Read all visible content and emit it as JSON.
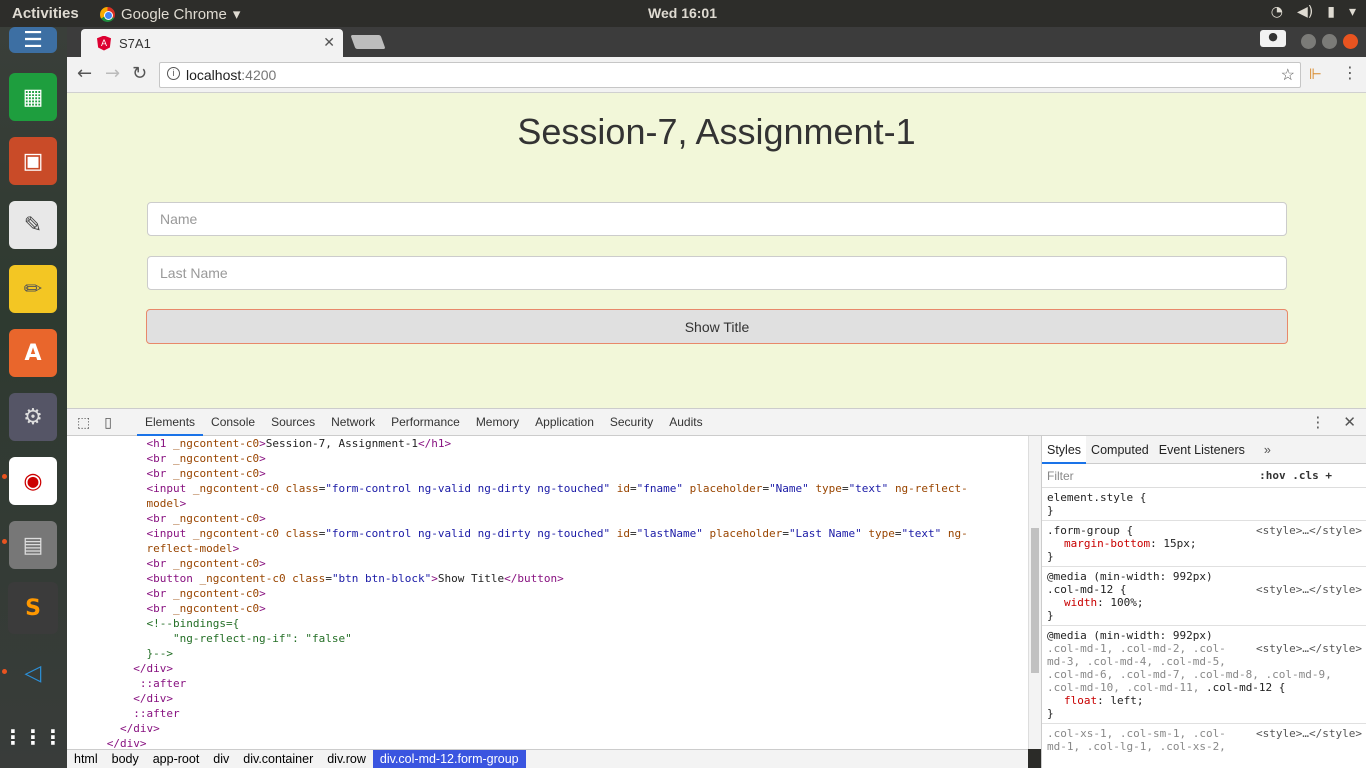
{
  "os_bar": {
    "activities": "Activities",
    "app_name": "Google Chrome",
    "clock": "Wed 16:01"
  },
  "dock": {
    "items": [
      "libreoffice-writer",
      "libreoffice-calc",
      "libreoffice-impress",
      "text-editor",
      "notes",
      "ubuntu-software",
      "system-tools",
      "okular",
      "scanner",
      "sublime-text",
      "vscode",
      "show-applications"
    ]
  },
  "browser": {
    "tab_title": "S7A1",
    "url_host": "localhost",
    "url_port": ":4200"
  },
  "page": {
    "heading": "Session-7, Assignment-1",
    "name_placeholder": "Name",
    "lastname_placeholder": "Last Name",
    "button_label": "Show Title"
  },
  "devtools": {
    "tabs": [
      "Elements",
      "Console",
      "Sources",
      "Network",
      "Performance",
      "Memory",
      "Application",
      "Security",
      "Audits"
    ],
    "active_tab": "Elements",
    "styles_tabs": [
      "Styles",
      "Computed",
      "Event Listeners"
    ],
    "filter_placeholder": "Filter",
    "hov": ":hov",
    "cls": ".cls",
    "breadcrumbs": [
      "html",
      "body",
      "app-root",
      "div",
      "div.container",
      "div.row",
      "div.col-md-12.form-group"
    ]
  },
  "styles": {
    "r1_sel": "element.style {",
    "r2_sel": ".form-group {",
    "r2_src": "<style>…</style>",
    "r2_pn": "margin-bottom",
    "r2_pv": "15px;",
    "r3_media": "@media (min-width: 992px)",
    "r3_sel": ".col-md-12 {",
    "r3_src": "<style>…</style>",
    "r3_pn": "width",
    "r3_pv": "100%;",
    "r4_media": "@media (min-width: 992px)",
    "r4_src": "<style>…</style>",
    "r4_sel1": ".col-md-1, .col-md-2, .col-",
    "r4_sel2": "md-3, .col-md-4, .col-md-5,",
    "r4_sel3": ".col-md-6, .col-md-7, .col-md-8, .col-md-9,",
    "r4_sel4": ".col-md-10, .col-md-11, ",
    "r4_sel4b": ".col-md-12 {",
    "r4_pn": "float",
    "r4_pv": "left;",
    "r5_sel1": ".col-xs-1, .col-sm-1, .col-",
    "r5_sel2": "md-1, .col-lg-1, .col-xs-2,",
    "r5_src": "<style>…</style>",
    "close_brace": "}"
  },
  "elements": {
    "l1_pre": "            ",
    "l1_text": "Session-7, Assignment-1",
    "l9_text": "Show Title",
    "bindings": "<!--bindings={",
    "binding_val": "  \"ng-reflect-ng-if\": \"false\"",
    "bindings_end": "}-->",
    "after": "::after"
  }
}
